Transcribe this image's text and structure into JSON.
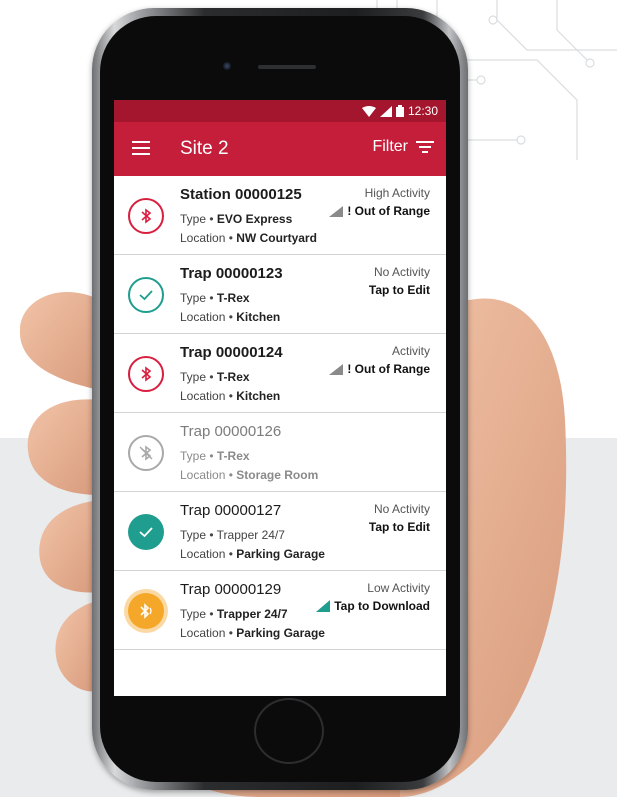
{
  "status": {
    "time": "12:30"
  },
  "appbar": {
    "title": "Site 2",
    "filter_label": "Filter"
  },
  "colors": {
    "primary": "#c41e3a",
    "primary_dark": "#a3162d",
    "alert_red": "#d81f3f",
    "ok_teal": "#1f9d8f",
    "inactive_grey": "#a9a9a9",
    "download_orange": "#f5a72a"
  },
  "icons": {
    "menu": "hamburger-icon",
    "filter": "filter-icon",
    "bluetooth": "bluetooth-icon",
    "check": "check-icon",
    "bluetooth_off": "bluetooth-disabled-icon",
    "bluetooth_transfer": "bluetooth-transfer-icon",
    "signal": "signal-icon",
    "download": "download-icon"
  },
  "list_labels": {
    "type": "Type • ",
    "location": "Location • "
  },
  "items": [
    {
      "title": "Station 00000125",
      "type": "EVO Express",
      "location": "NW Courtyard",
      "activity": "High Activity",
      "action": "! Out of Range"
    },
    {
      "title": "Trap 00000123",
      "type": "T-Rex",
      "location": "Kitchen",
      "activity": "No Activity",
      "action": "Tap to Edit"
    },
    {
      "title": "Trap 00000124",
      "type": "T-Rex",
      "location": "Kitchen",
      "activity": "Activity",
      "action": "! Out of Range"
    },
    {
      "title": "Trap 00000126",
      "type": "T-Rex",
      "location": "Storage Room",
      "activity": "",
      "action": ""
    },
    {
      "title": "Trap 00000127",
      "type": "Trapper 24/7",
      "location": "Parking Garage",
      "activity": "No Activity",
      "action": "Tap to Edit"
    },
    {
      "title": "Trap 00000129",
      "type": "Trapper 24/7",
      "location": "Parking Garage",
      "activity": "Low Activity",
      "action": "Tap to Download"
    }
  ]
}
